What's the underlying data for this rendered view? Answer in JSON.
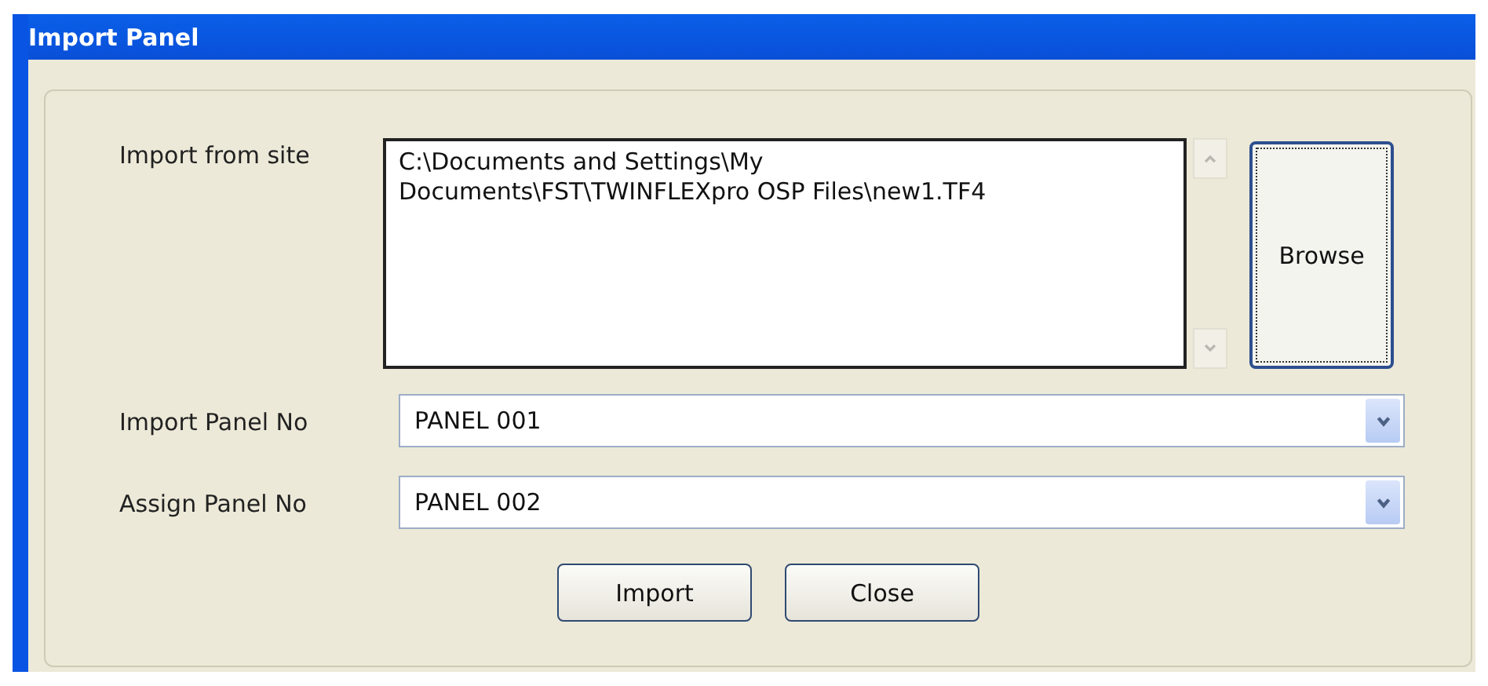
{
  "window": {
    "title": "Import Panel"
  },
  "import_from_site": {
    "label": "Import from site",
    "value": "C:\\Documents and Settings\\My Documents\\FST\\TWINFLEXpro OSP Files\\new1.TF4"
  },
  "browse_button": {
    "label": "Browse",
    "focused": true
  },
  "selects": [
    {
      "label": "Import Panel No",
      "value": "PANEL 001"
    },
    {
      "label": "Assign Panel No",
      "value": "PANEL 002"
    }
  ],
  "buttons": [
    "Import",
    "Close"
  ]
}
